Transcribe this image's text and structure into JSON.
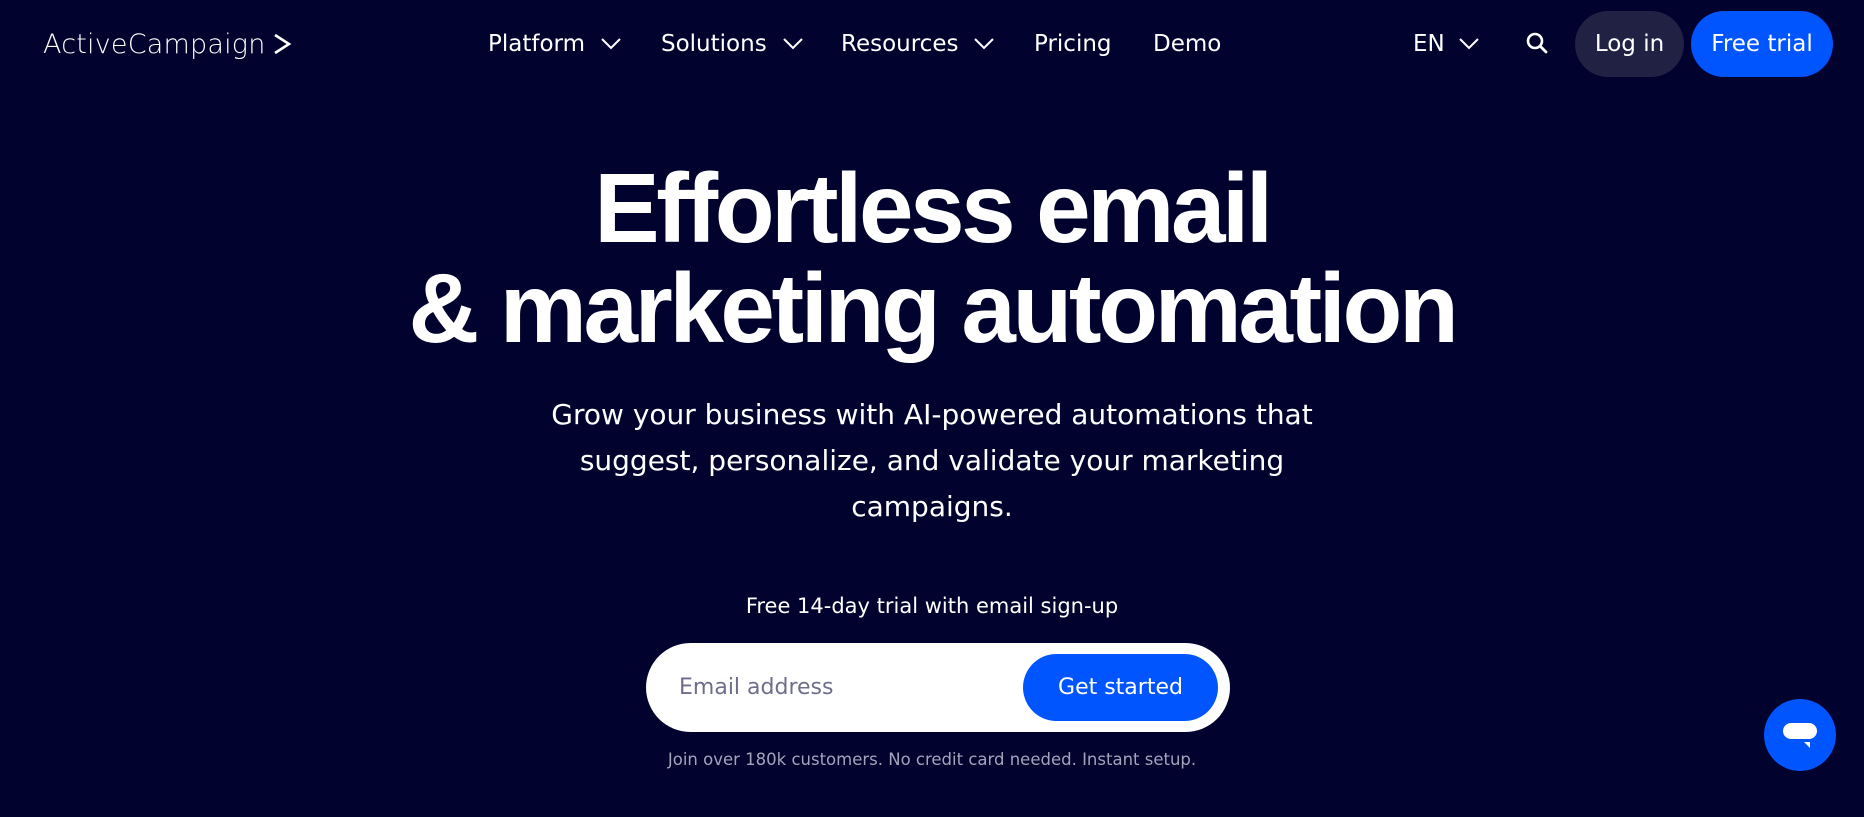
{
  "header": {
    "logo_text": "ActiveCampaign",
    "logo_icon": "chevron-right-icon",
    "nav": [
      {
        "label": "Platform",
        "has_dropdown": true
      },
      {
        "label": "Solutions",
        "has_dropdown": true
      },
      {
        "label": "Resources",
        "has_dropdown": true
      },
      {
        "label": "Pricing",
        "has_dropdown": false
      },
      {
        "label": "Demo",
        "has_dropdown": false
      }
    ],
    "language": {
      "label": "EN",
      "icon": "chevron-down-icon"
    },
    "search_icon": "search-icon",
    "login_label": "Log in",
    "free_trial_label": "Free trial"
  },
  "hero": {
    "headline_lines": [
      "Effortless email",
      "& marketing automation"
    ],
    "subtitle_lines": [
      "Grow your business with AI-powered automations that",
      "suggest, personalize, and validate your marketing",
      "campaigns."
    ],
    "trial_label": "Free 14-day trial with email sign-up",
    "email": {
      "placeholder": "Email address",
      "value": ""
    },
    "cta_label": "Get started",
    "disclaimer": "Join over 180k customers. No credit card needed. Instant setup."
  },
  "chat_widget": {
    "icon": "chat-bubble-icon"
  },
  "colors": {
    "background": "#02022e",
    "accent": "#0055ff",
    "login_pill": "#212243",
    "placeholder": "#6e6e8c",
    "disclaimer": "#a3a3bb"
  }
}
